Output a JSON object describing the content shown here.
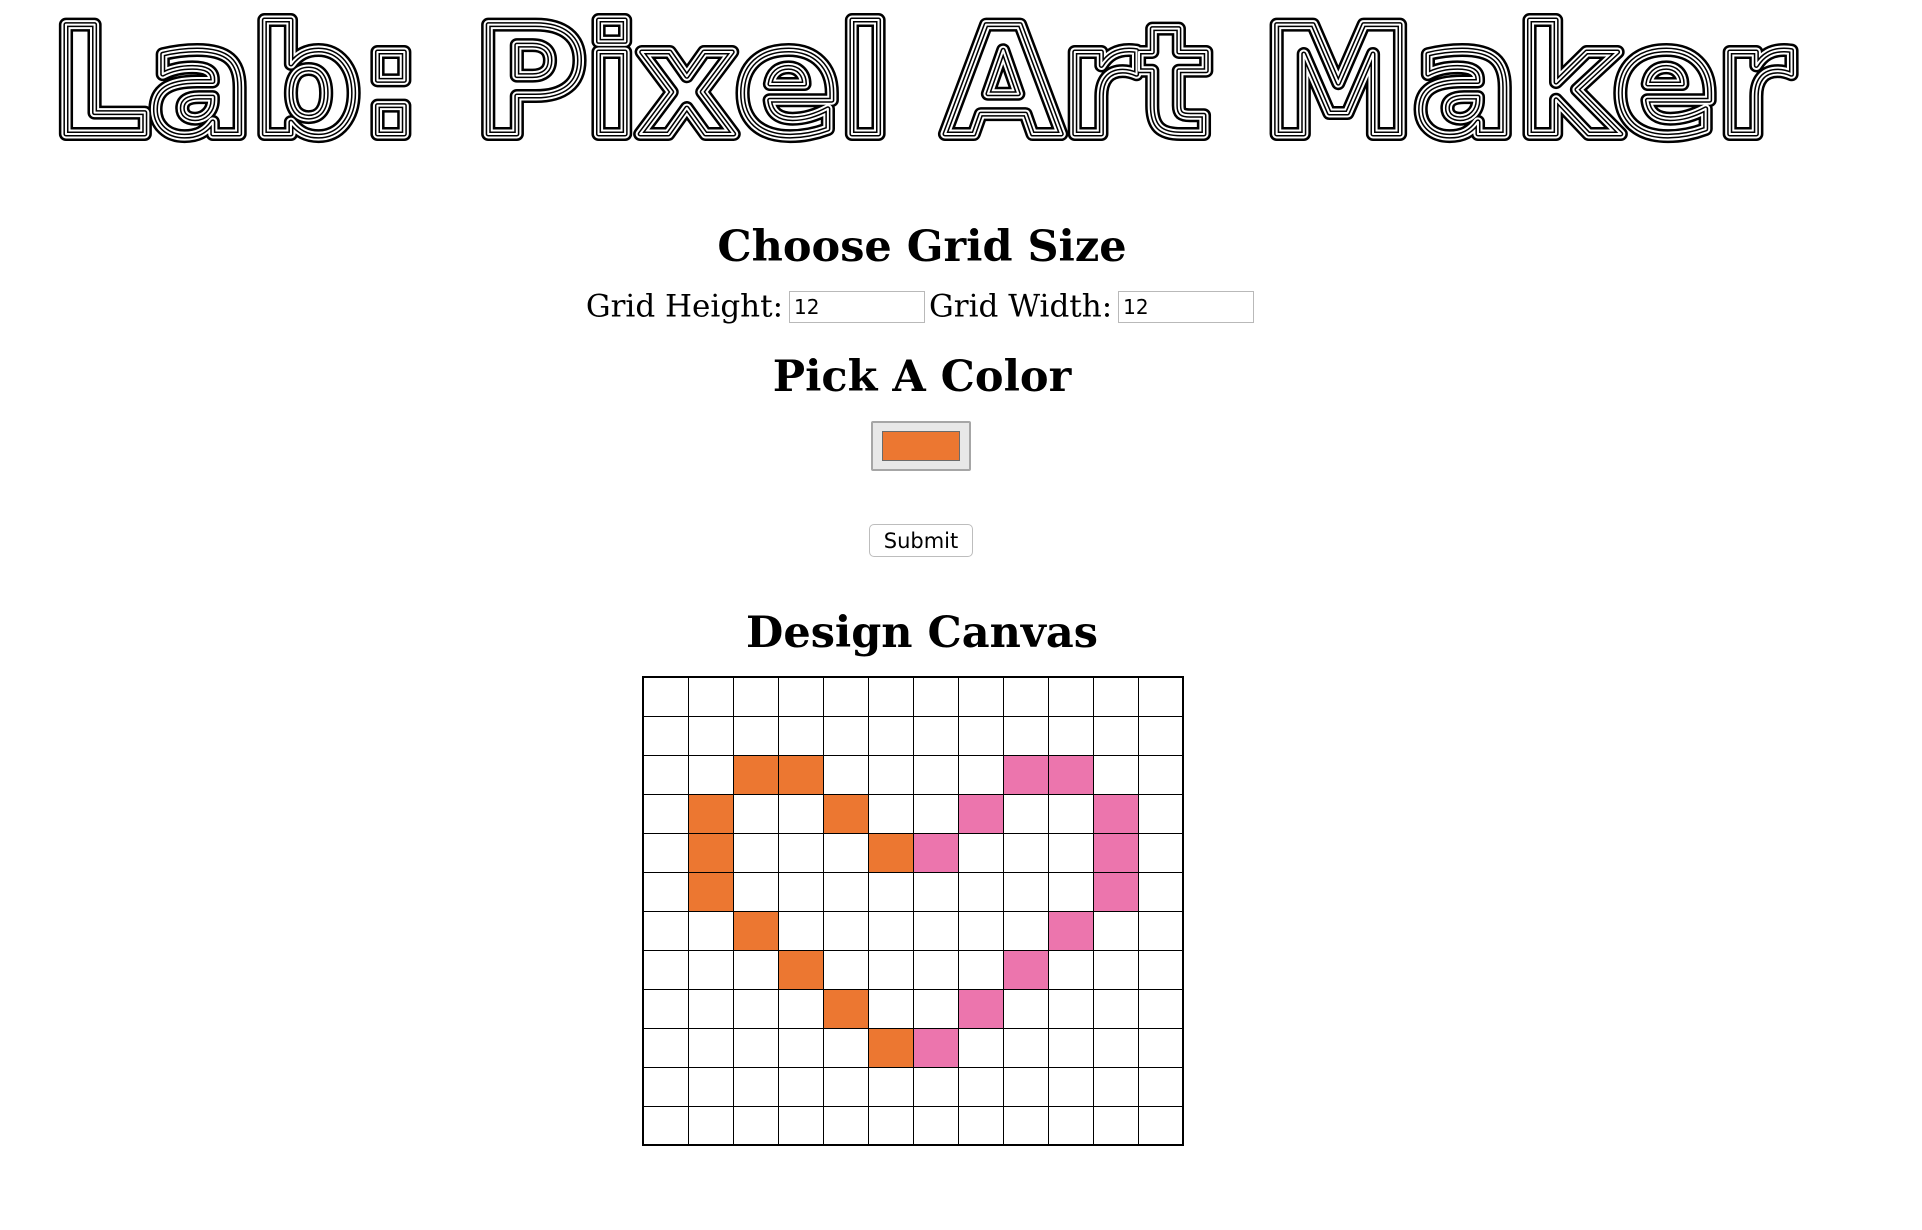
{
  "page": {
    "title": "Lab: Pixel Art Maker"
  },
  "grid_size": {
    "heading": "Choose Grid Size",
    "height_label": "Grid Height:",
    "height_value": "12",
    "width_label": "Grid Width:",
    "width_value": "12"
  },
  "color": {
    "heading": "Pick A Color",
    "value": "#ec7731"
  },
  "submit": {
    "label": "Submit"
  },
  "canvas": {
    "heading": "Design Canvas",
    "rows": 12,
    "cols": 12,
    "palette": {
      "o": "#ec7731",
      "p": "#ec75ad"
    },
    "cells": [
      "............",
      "............",
      "..oo....pp..",
      ".o..o..p..p.",
      ".o...op...p.",
      ".o........p.",
      "..o......p..",
      "...o....p...",
      "....o..p....",
      ".....op.....",
      "............",
      "............"
    ]
  }
}
